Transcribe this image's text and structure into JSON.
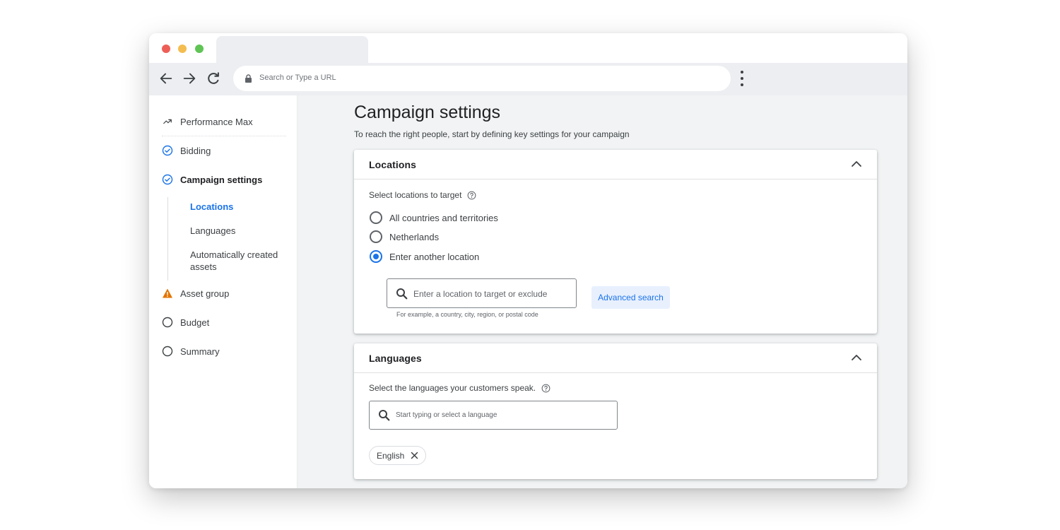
{
  "browser": {
    "url_placeholder": "Search or Type a URL",
    "traffic_colors": [
      "#ed5f56",
      "#f4bd4f",
      "#5fc454"
    ]
  },
  "sidebar": {
    "items": [
      {
        "label": "Performance Max",
        "icon": "trend-icon"
      },
      {
        "label": "Bidding",
        "icon": "check-circle-icon",
        "status": "complete"
      },
      {
        "label": "Campaign settings",
        "icon": "check-circle-icon",
        "status": "complete"
      },
      {
        "label": "Asset group",
        "icon": "warning-icon",
        "status": "warning"
      },
      {
        "label": "Budget",
        "icon": "empty-circle-icon",
        "status": "incomplete"
      },
      {
        "label": "Summary",
        "icon": "empty-circle-icon",
        "status": "incomplete"
      }
    ],
    "sub_items": [
      {
        "label": "Locations",
        "active": true
      },
      {
        "label": "Languages",
        "active": false
      },
      {
        "label": "Automatically created assets",
        "active": false
      }
    ]
  },
  "main": {
    "title": "Campaign settings",
    "subtitle": "To reach the right people, start by defining key settings for your campaign",
    "locations": {
      "title": "Locations",
      "label": "Select locations to target",
      "options": [
        {
          "label": "All countries and territories",
          "checked": false
        },
        {
          "label": "Netherlands",
          "checked": false
        },
        {
          "label": "Enter another location",
          "checked": true
        }
      ],
      "input_placeholder": "Enter a location to target or exclude",
      "hint": "For example, a country, city, region, or postal code",
      "advanced_button": "Advanced search"
    },
    "languages": {
      "title": "Languages",
      "label": "Select the languages your customers speak.",
      "input_placeholder": "Start typing or select a language",
      "selected": [
        "English"
      ]
    }
  },
  "colors": {
    "accent": "#1a73e8",
    "warning": "#e37400",
    "page_bg": "#f1f3f4"
  }
}
